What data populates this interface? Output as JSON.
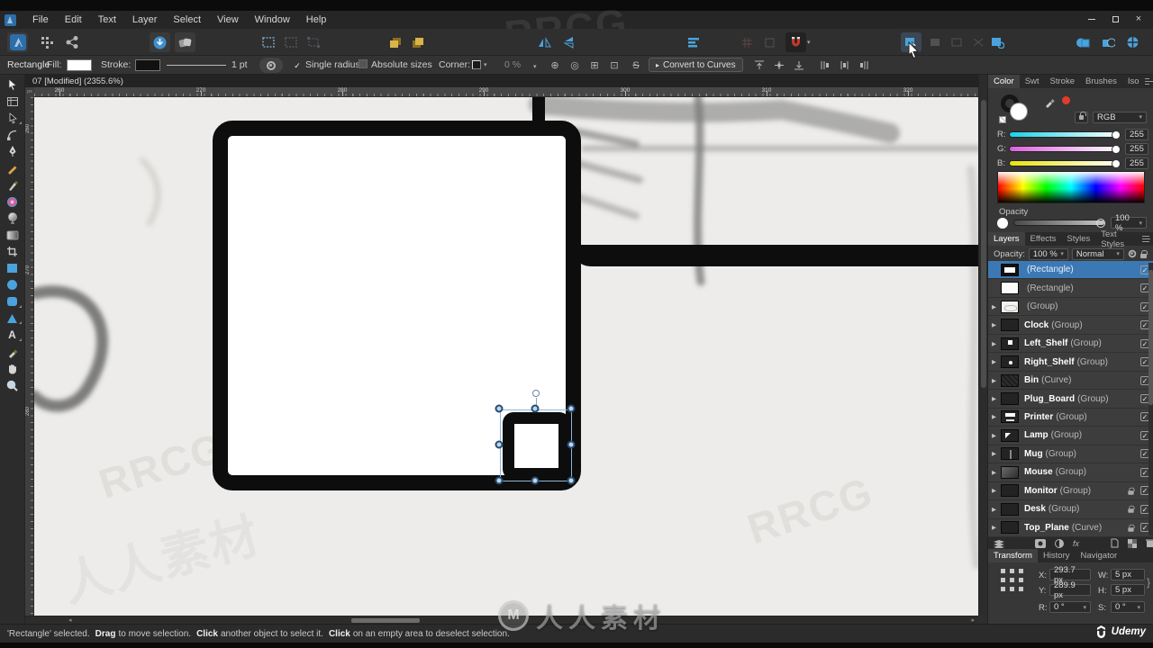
{
  "window": {
    "minimize": "–",
    "maximize": "",
    "close": "×"
  },
  "menu": [
    "File",
    "Edit",
    "Text",
    "Layer",
    "Select",
    "View",
    "Window",
    "Help"
  ],
  "context": {
    "tool": "Rectangle",
    "fill": "Fill:",
    "stroke": "Stroke:",
    "width": "1 pt",
    "single_radius": "Single radius",
    "single_radius_check": "✓",
    "absolute_sizes": "Absolute sizes",
    "corner": "Corner:",
    "corner_value": "0 %",
    "snap_glyphs": {
      "g1": "⊕",
      "g2": "◎",
      "g3": "⊞",
      "g4": "⊡",
      "g5": "S"
    },
    "convert": "Convert to Curves",
    "convert_arrow": "▸"
  },
  "tab": {
    "title": "07 [Modified] (2355.6%)",
    "close": "×"
  },
  "ruler": {
    "unit": "px",
    "h": [
      "260",
      "270",
      "280",
      "290",
      "300",
      "310",
      "320"
    ],
    "v": [
      "260",
      "270",
      "280"
    ]
  },
  "color": {
    "tabs": [
      "Color",
      "Swt",
      "Stroke",
      "Brushes",
      "Iso"
    ],
    "mode": "RGB",
    "r_label": "R:",
    "r": "255",
    "g_label": "G:",
    "g": "255",
    "b_label": "B:",
    "b": "255",
    "opacity_label": "Opacity",
    "opacity": "100 %"
  },
  "layers": {
    "tabs": [
      "Layers",
      "Effects",
      "Styles",
      "Text Styles"
    ],
    "opacity_label": "Opacity:",
    "opacity": "100 %",
    "blend": "Normal",
    "check": "✓",
    "arrow": "▶",
    "fx_label": "fx",
    "rows": [
      {
        "name": "",
        "type": "(Rectangle)"
      },
      {
        "name": "",
        "type": "(Rectangle)"
      },
      {
        "name": "",
        "type": "(Group)"
      },
      {
        "name": "Clock",
        "type": "(Group)"
      },
      {
        "name": "Left_Shelf",
        "type": "(Group)"
      },
      {
        "name": "Right_Shelf",
        "type": "(Group)"
      },
      {
        "name": "Bin",
        "type": "(Curve)"
      },
      {
        "name": "Plug_Board",
        "type": "(Group)"
      },
      {
        "name": "Printer",
        "type": "(Group)"
      },
      {
        "name": "Lamp",
        "type": "(Group)"
      },
      {
        "name": "Mug",
        "type": "(Group)"
      },
      {
        "name": "Mouse",
        "type": "(Group)"
      },
      {
        "name": "Monitor",
        "type": "(Group)"
      },
      {
        "name": "Desk",
        "type": "(Group)"
      },
      {
        "name": "Top_Plane",
        "type": "(Curve)"
      }
    ]
  },
  "transform": {
    "tabs": [
      "Transform",
      "History",
      "Navigator"
    ],
    "x_label": "X:",
    "x": "293.7 px",
    "y_label": "Y:",
    "y": "289.9 px",
    "w_label": "W:",
    "w": "5 px",
    "h_label": "H:",
    "h": "5 px",
    "r_label": "R:",
    "r": "0 °",
    "s_label": "S:",
    "s": "0 °",
    "link": "}"
  },
  "status": {
    "p1": "'Rectangle' selected.",
    "b1": "Drag",
    "p2": "to move selection.",
    "b2": "Click",
    "p3": "another object to select it.",
    "b3": "Click",
    "p4": "on an empty area to deselect selection."
  },
  "brand": {
    "udemy": "Udemy",
    "udemy_mark": "u",
    "watermark": "RRCG",
    "watermark_cn": "人人素材",
    "logo_letter": "M"
  },
  "colors": {
    "accent": "#4aa3dc",
    "selection_row": "#3c79b4",
    "magnet": "#c0392b",
    "ink": "#0d0d0d",
    "artboard": "#edecea"
  }
}
